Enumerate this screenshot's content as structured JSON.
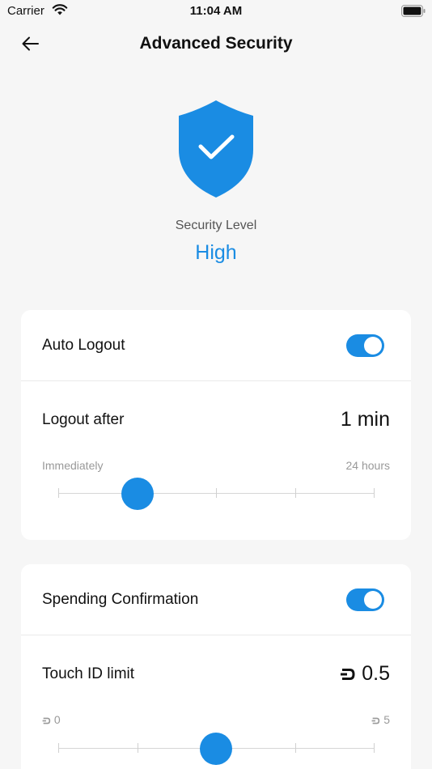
{
  "status_bar": {
    "carrier": "Carrier",
    "time": "11:04 AM"
  },
  "nav": {
    "title": "Advanced Security",
    "back_icon": "arrow-left-icon"
  },
  "header": {
    "shield_icon": "shield-check-icon",
    "security_label": "Security Level",
    "security_value": "High"
  },
  "auto_logout": {
    "label": "Auto Logout",
    "toggle_on": true,
    "logout_after_label": "Logout after",
    "logout_after_value": "1 min",
    "range_min": "Immediately",
    "range_max": "24 hours",
    "slider_steps": 5,
    "slider_index": 1
  },
  "spending": {
    "label": "Spending Confirmation",
    "toggle_on": true,
    "limit_label": "Touch ID limit",
    "limit_value": "0.5",
    "range_min": "0",
    "range_max": "5",
    "currency_icon": "dash-currency-icon",
    "slider_steps": 5,
    "slider_index": 2
  },
  "colors": {
    "accent": "#1a8ce3",
    "background": "#f6f6f6",
    "card": "#ffffff"
  }
}
